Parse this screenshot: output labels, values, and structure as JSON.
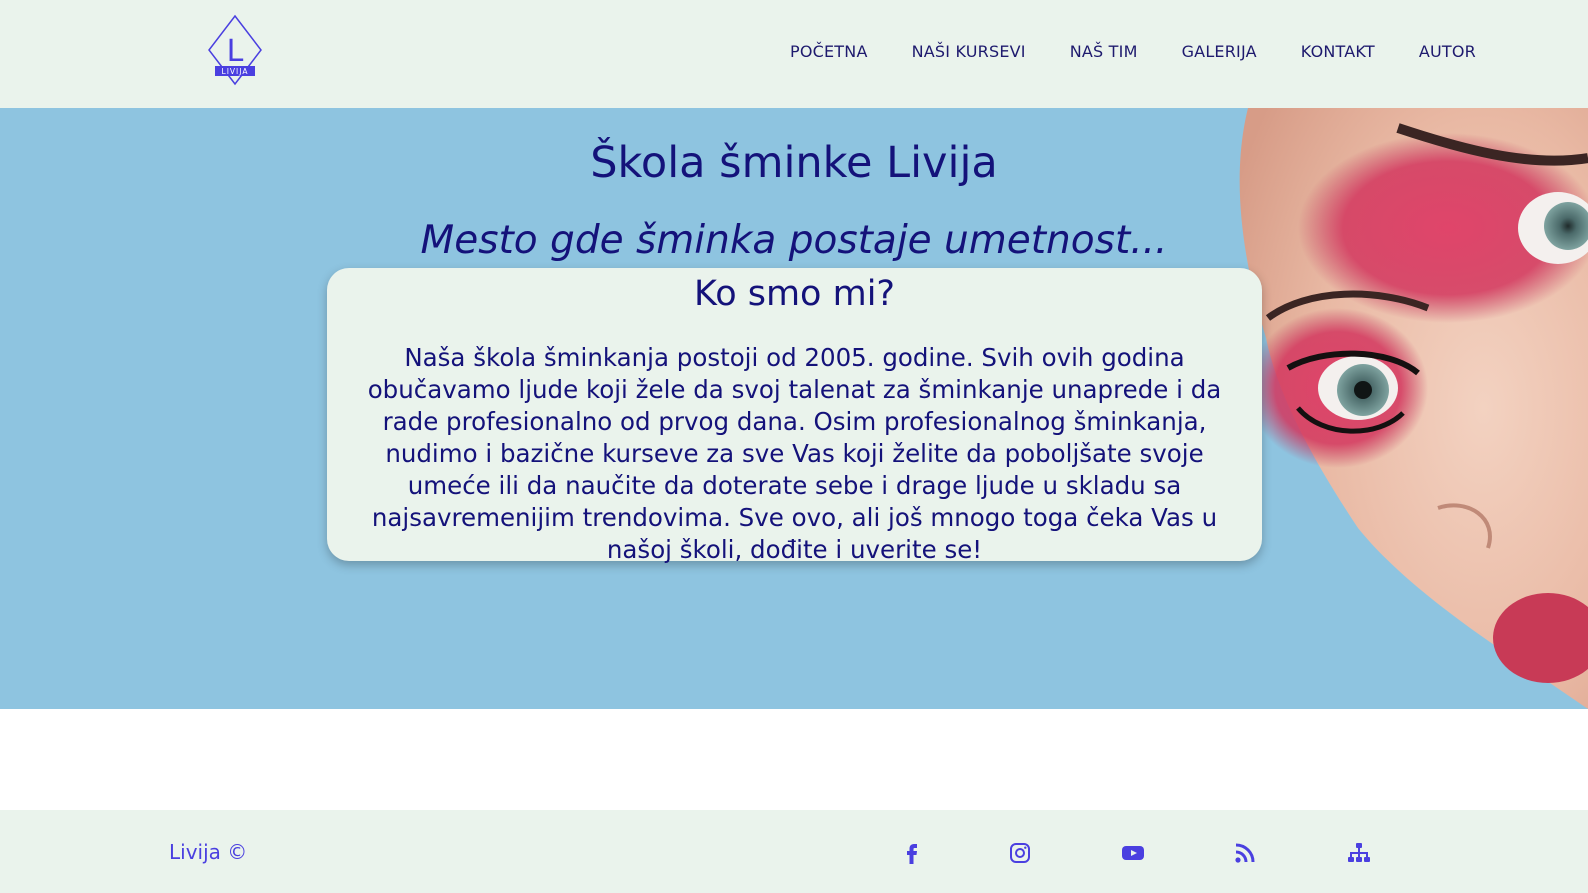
{
  "header": {
    "logo": {
      "letter": "L",
      "text": "LIVIJA"
    },
    "nav": [
      {
        "label": "POČETNA"
      },
      {
        "label": "NAŠI KURSEVI"
      },
      {
        "label": "NAŠ TIM"
      },
      {
        "label": "GALERIJA"
      },
      {
        "label": "KONTAKT"
      },
      {
        "label": "AUTOR"
      }
    ]
  },
  "hero": {
    "title": "Škola šminke Livija",
    "tagline": "Mesto gde šminka postaje umetnost...",
    "card": {
      "heading": "Ko smo mi?",
      "body": "Naša škola šminkanja postoji od 2005. godine. Svih ovih godina obučavamo ljude koji žele da svoj talenat za šminkanje unaprede i da rade profesionalno od prvog dana. Osim profesionalnog šminkanja, nudimo i bazične kurseve za sve Vas koji želite da poboljšate svoje umeće ili da naučite da doterate sebe i drage ljude u skladu sa najsavremenijim trendovima. Sve ovo, ali još mnogo toga čeka Vas u našoj školi, dođite i uverite se!"
    }
  },
  "footer": {
    "copyright": "Livija ©",
    "social": [
      "facebook-icon",
      "instagram-icon",
      "youtube-icon",
      "rss-icon",
      "sitemap-icon"
    ]
  },
  "colors": {
    "header_bg": "#eaf3ec",
    "hero_bg": "#8ec4e0",
    "text_primary": "#14127a",
    "accent": "#4a3fe0"
  }
}
